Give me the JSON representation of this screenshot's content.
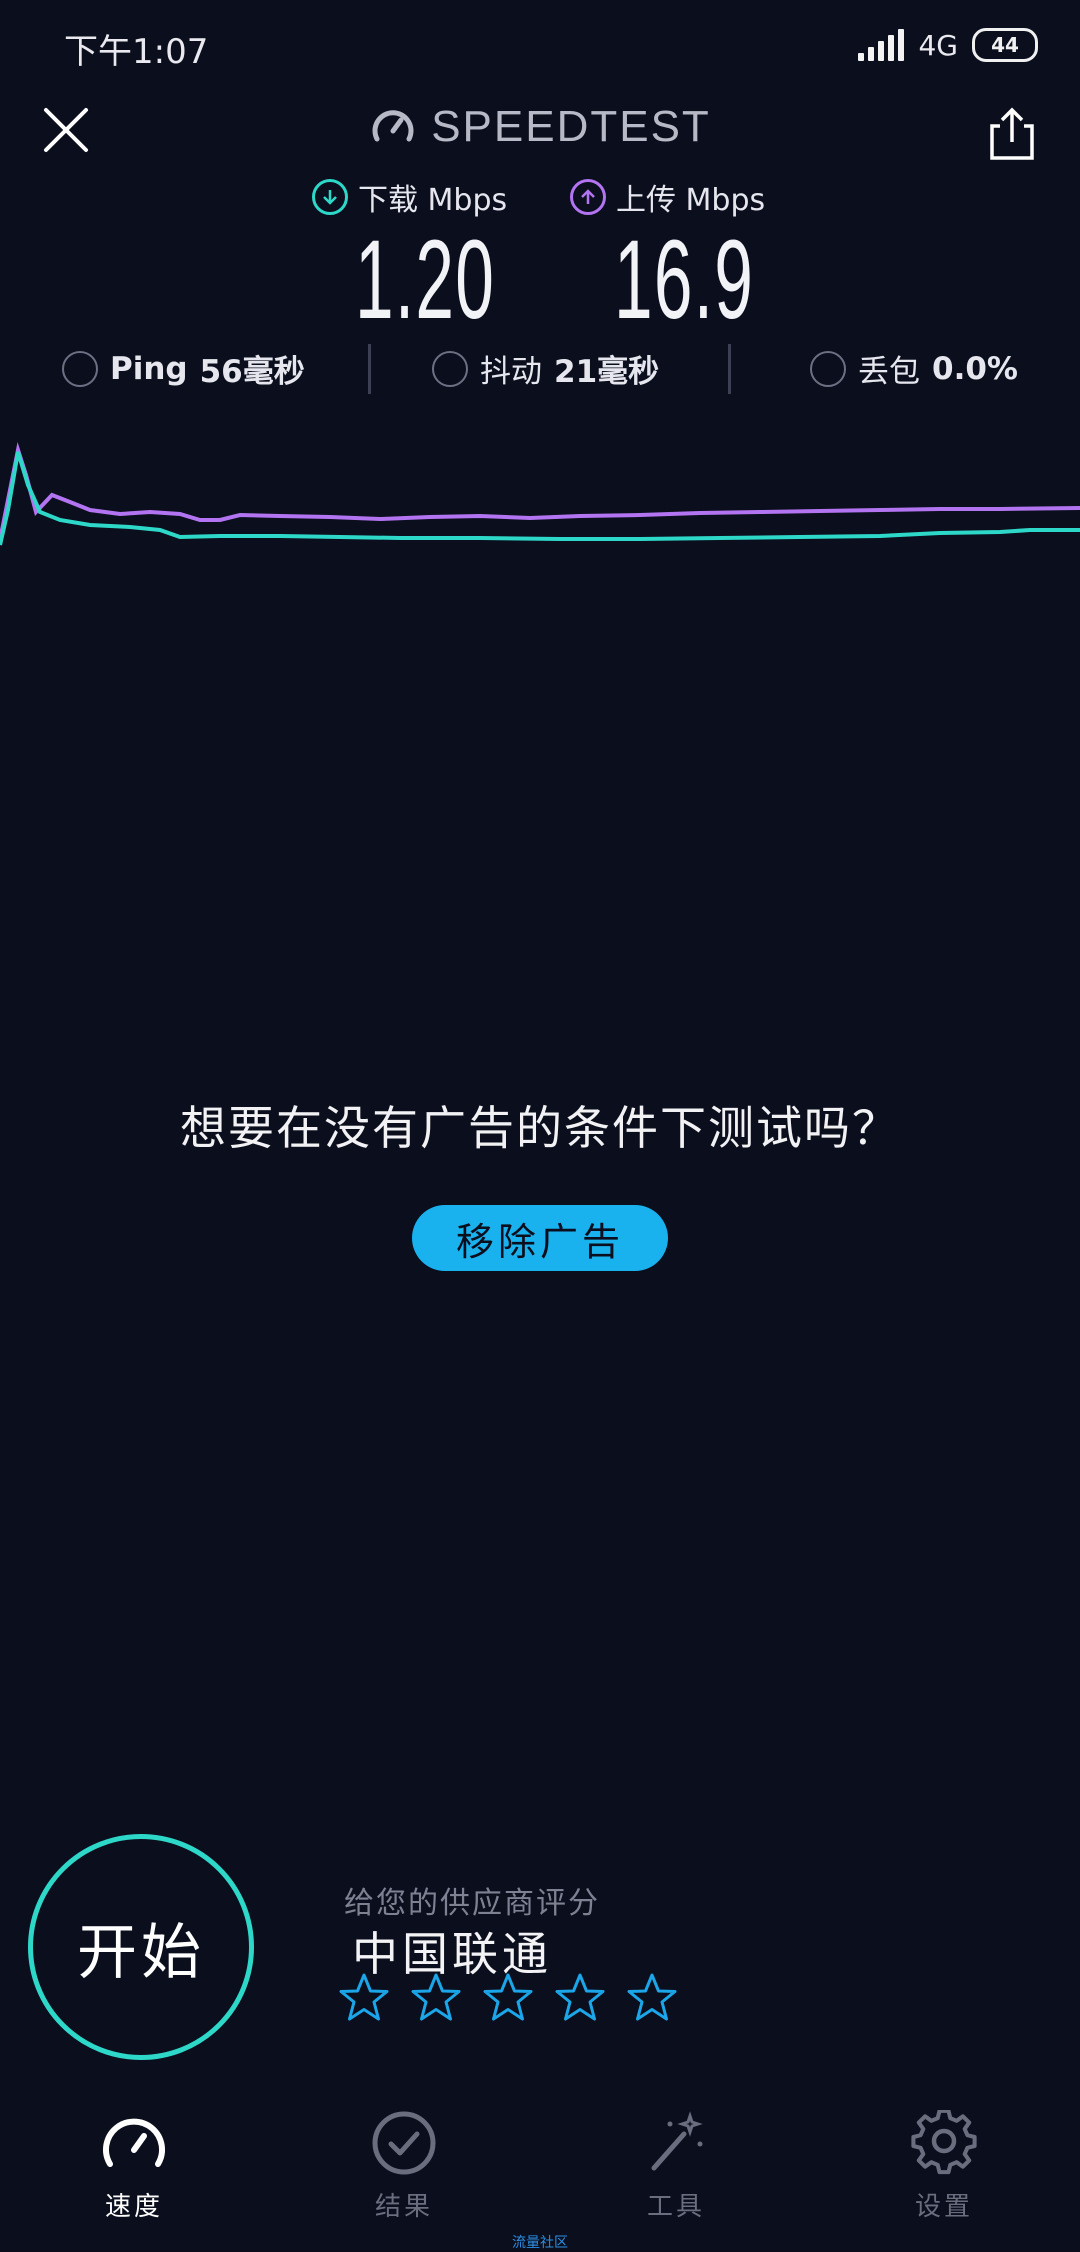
{
  "status_bar": {
    "time": "下午1:07",
    "network": "4G",
    "battery": "44"
  },
  "header": {
    "title": "SPEEDTEST"
  },
  "download": {
    "label": "下载 Mbps",
    "value": "1.20",
    "color": "#2ed8c9"
  },
  "upload": {
    "label": "上传 Mbps",
    "value": "16.9",
    "color": "#b374f2"
  },
  "ping": {
    "label": "Ping",
    "value": "56毫秒"
  },
  "jitter": {
    "label": "抖动",
    "value": "21毫秒"
  },
  "loss": {
    "label": "丢包",
    "value": "0.0%"
  },
  "ad": {
    "text": "想要在没有广告的条件下测试吗？",
    "button": "移除广告"
  },
  "start": {
    "label": "开始"
  },
  "rating": {
    "hint": "给您的供应商评分",
    "provider": "中国联通",
    "stars": 5
  },
  "nav": [
    {
      "label": "速度",
      "icon": "speedometer-icon",
      "active": true
    },
    {
      "label": "结果",
      "icon": "checkmark-circle-icon",
      "active": false
    },
    {
      "label": "工具",
      "icon": "magic-wand-icon",
      "active": false
    },
    {
      "label": "设置",
      "icon": "gear-icon",
      "active": false
    }
  ],
  "watermark": "流量社区"
}
